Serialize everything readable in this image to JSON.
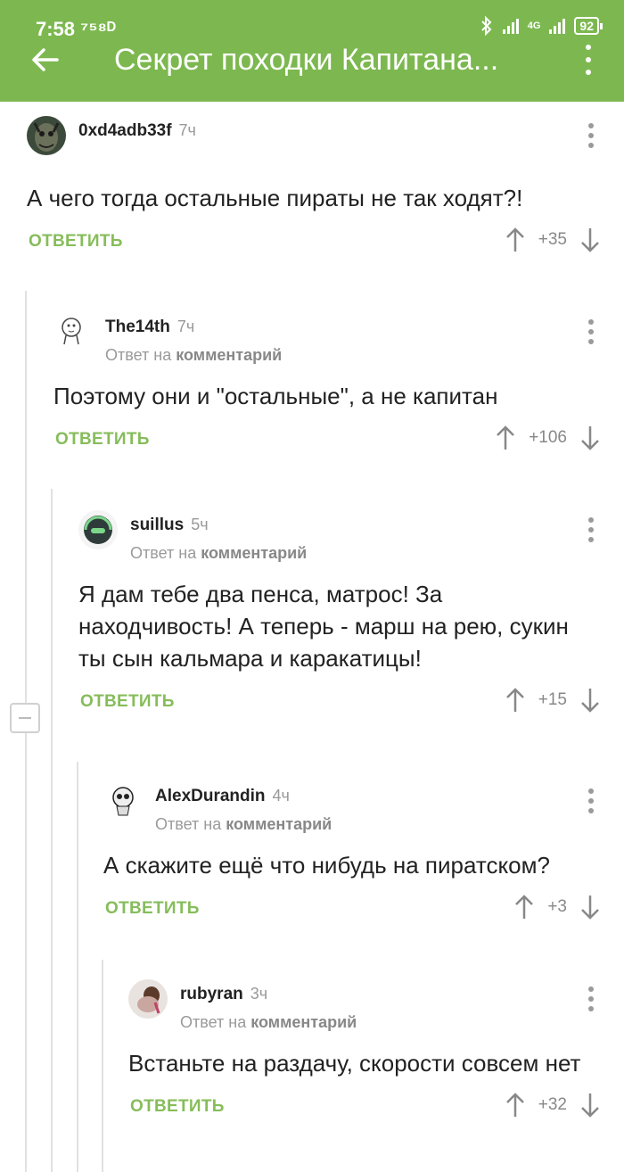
{
  "status_bar": {
    "time": "7:58 ⁷⁵⁸ᴰ",
    "network": "4G",
    "battery": "92"
  },
  "header": {
    "title": "Секрет походки Капитана..."
  },
  "comments": [
    {
      "username": "0xd4adb33f",
      "age": "7ч",
      "reply_to": "",
      "text": "А чего тогда остальные пираты не так ходят?!",
      "reply_label": "ОТВЕТИТЬ",
      "score": "+35"
    },
    {
      "username": "The14th",
      "age": "7ч",
      "reply_to": "Ответ на",
      "reply_target": "комментарий",
      "text": "Поэтому они и \"остальные\", а не капитан",
      "reply_label": "ОТВЕТИТЬ",
      "score": "+106"
    },
    {
      "username": "suillus",
      "age": "5ч",
      "reply_to": "Ответ на",
      "reply_target": "комментарий",
      "text": "Я дам тебе два пенса, матрос! За находчивость! А теперь - марш на рею, сукин ты сын кальмара и каракатицы!",
      "reply_label": "ОТВЕТИТЬ",
      "score": "+15"
    },
    {
      "username": "AlexDurandin",
      "age": "4ч",
      "reply_to": "Ответ на",
      "reply_target": "комментарий",
      "text": "А скажите ещё что нибудь на пиратском?",
      "reply_label": "ОТВЕТИТЬ",
      "score": "+3"
    },
    {
      "username": "rubyran",
      "age": "3ч",
      "reply_to": "Ответ на",
      "reply_target": "комментарий",
      "text": "Встаньте на раздачу, скорости совсем нет",
      "reply_label": "ОТВЕТИТЬ",
      "score": "+32"
    }
  ],
  "colors": {
    "appbar": "#7cb84f",
    "accent": "#86bd5a",
    "muted": "#999999"
  }
}
